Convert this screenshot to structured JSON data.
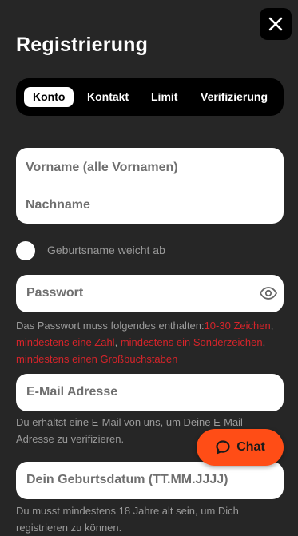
{
  "header": {
    "title": "Registrierung",
    "close_icon": "close-icon"
  },
  "tabs": [
    {
      "label": "Konto",
      "active": true
    },
    {
      "label": "Kontakt",
      "active": false
    },
    {
      "label": "Limit",
      "active": false
    },
    {
      "label": "Verifizierung",
      "active": false
    }
  ],
  "form": {
    "first_name_placeholder": "Vorname (alle Vornamen)",
    "last_name_placeholder": "Nachname",
    "birth_name_toggle_label": "Geburtsname weicht ab",
    "password_placeholder": "Passwort",
    "password_hint": {
      "prefix": "Das Passwort muss folgendes enthalten:",
      "rules": [
        "10-30 Zeichen",
        "mindestens eine Zahl",
        "mindestens ein Sonderzeichen",
        "mindestens einen Großbuchstaben"
      ],
      "separator": ", "
    },
    "email_placeholder": "E-Mail Adresse",
    "email_hint": "Du erhältst eine E-Mail von uns, um Deine E-Mail Adresse zu verifizieren.",
    "birthdate_placeholder": "Dein Geburtsdatum (TT.MM.JJJJ)",
    "birthdate_hint": "Du musst mindestens 18 Jahre alt sein, um Dich registrieren zu können."
  },
  "chat": {
    "label": "Chat",
    "icon": "chat-bubble-icon"
  },
  "colors": {
    "background": "#262626",
    "accent": "#ff4d16",
    "error": "#d6242a"
  }
}
